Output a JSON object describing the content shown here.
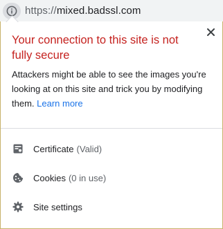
{
  "omnibox": {
    "url_scheme": "https://",
    "url_host": "mixed.badssl.com",
    "info_icon": "info-icon"
  },
  "bubble": {
    "title": "Your connection to this site is not fully secure",
    "description": "Attackers might be able to see the images you're looking at on this site and trick you by modifying them.",
    "learn_more": "Learn more",
    "close_icon": "close-icon",
    "title_color": "#c5221f",
    "link_color": "#1a73e8"
  },
  "items": [
    {
      "icon": "certificate-icon",
      "label": "Certificate",
      "sub": "(Valid)"
    },
    {
      "icon": "cookie-icon",
      "label": "Cookies",
      "sub": "(0 in use)"
    },
    {
      "icon": "gear-icon",
      "label": "Site settings",
      "sub": ""
    }
  ]
}
